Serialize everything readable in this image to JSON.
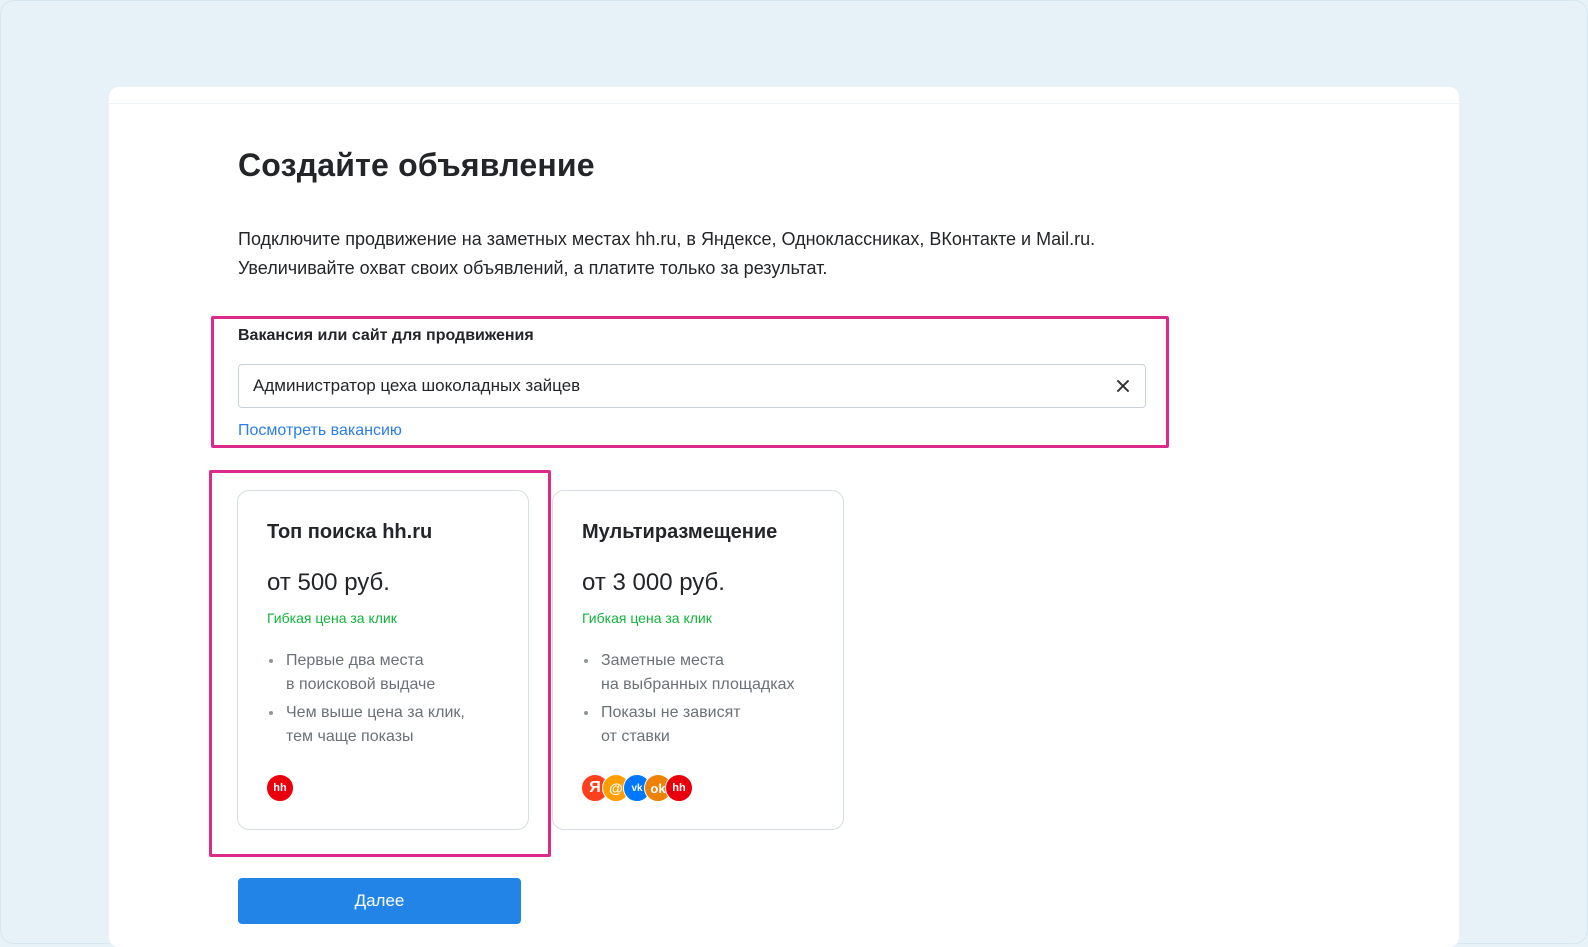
{
  "page": {
    "title": "Создайте объявление",
    "intro_line1": "Подключите продвижение на заметных местах hh.ru, в Яндексе, Одноклассниках, ВКонтакте и Mail.ru.",
    "intro_line2": "Увеличивайте охват своих объявлений, а платите только за результат."
  },
  "field": {
    "label": "Вакансия или сайт для продвижения",
    "value": "Администратор цеха шоколадных зайцев",
    "view_link": "Посмотреть вакансию"
  },
  "options": [
    {
      "title": "Топ поиска hh.ru",
      "price": "от 500 руб.",
      "note": "Гибкая цена за клик",
      "bullets": [
        [
          "Первые два места",
          "в поисковой выдаче"
        ],
        [
          "Чем выше цена за клик,",
          "тем чаще показы"
        ]
      ],
      "logos": [
        {
          "name": "hh-logo",
          "text": "hh",
          "color": "#e8000d"
        }
      ]
    },
    {
      "title": "Мультиразмещение",
      "price": "от 3 000 руб.",
      "note": "Гибкая цена за клик",
      "bullets": [
        [
          "Заметные места",
          "на выбранных площадках"
        ],
        [
          "Показы не зависят",
          "от ставки"
        ]
      ],
      "logos": [
        {
          "name": "yandex-logo",
          "text": "Я",
          "color": "#fc3f1d"
        },
        {
          "name": "mail-logo",
          "text": "@",
          "color": "#ff9e00"
        },
        {
          "name": "vk-logo",
          "text": "vk",
          "color": "#0077ff"
        },
        {
          "name": "ok-logo",
          "text": "ok",
          "color": "#ee8208"
        },
        {
          "name": "hh-logo",
          "text": "hh",
          "color": "#e8000d"
        }
      ]
    }
  ],
  "actions": {
    "next_label": "Далее"
  },
  "colors": {
    "accent": "#2284e6",
    "highlight": "#dc2a8b",
    "note_green": "#12b33b"
  }
}
